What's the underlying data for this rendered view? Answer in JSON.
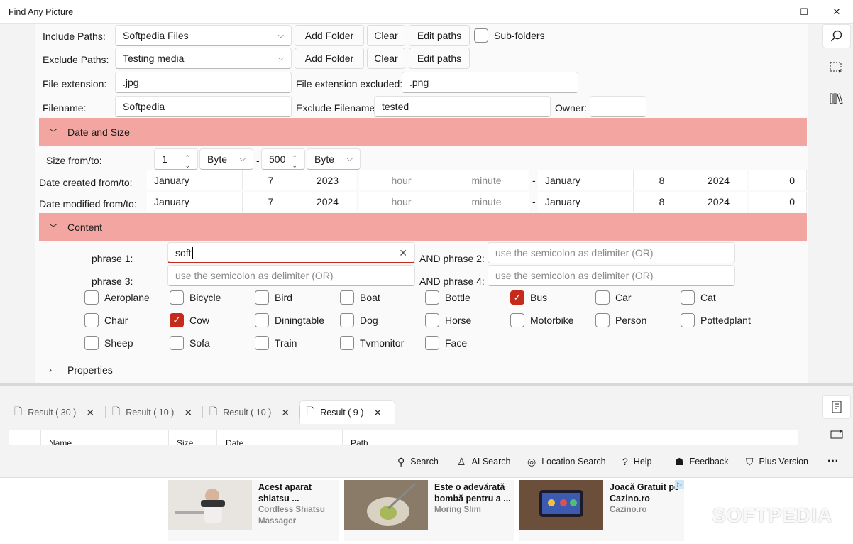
{
  "window": {
    "title": "Find Any Picture",
    "min": "—",
    "max": "☐",
    "close": "✕"
  },
  "include": {
    "label": "Include Paths:",
    "value": "Softpedia Files",
    "add": "Add Folder",
    "clear": "Clear",
    "edit": "Edit paths",
    "subfolders": "Sub-folders"
  },
  "exclude": {
    "label": "Exclude Paths:",
    "value": "Testing media",
    "add": "Add Folder",
    "clear": "Clear",
    "edit": "Edit paths"
  },
  "ext": {
    "label": "File extension:",
    "value": ".jpg",
    "ex_label": "File extension excluded:",
    "ex_value": ".png"
  },
  "fname": {
    "label": "Filename:",
    "value": "Softpedia",
    "ex_label": "Exclude Filename:",
    "ex_value": "tested",
    "owner_label": "Owner:",
    "owner_value": ""
  },
  "date_section": {
    "title": "Date and Size"
  },
  "size": {
    "label": "Size from/to:",
    "from": "1",
    "from_unit": "Byte",
    "dash": "-",
    "to": "500",
    "to_unit": "Byte"
  },
  "created": {
    "label": "Date created from/to:",
    "m1": "January",
    "d1": "7",
    "y1": "2023",
    "hour": "hour",
    "minute": "minute",
    "dash": "-",
    "m2": "January",
    "d2": "8",
    "y2": "2024",
    "h2": "0"
  },
  "modified": {
    "label": "Date modified from/to:",
    "m1": "January",
    "d1": "7",
    "y1": "2024",
    "hour": "hour",
    "minute": "minute",
    "dash": "-",
    "m2": "January",
    "d2": "8",
    "y2": "2024",
    "h2": "0"
  },
  "content_section": {
    "title": "Content"
  },
  "phrases": {
    "p1_label": "phrase 1:",
    "p1_value": "soft",
    "p2_label": "AND phrase 2:",
    "p2_placeholder": "use the semicolon as delimiter (OR)",
    "p3_label": "phrase 3:",
    "p3_placeholder": "use the semicolon as delimiter (OR)",
    "p4_label": "AND phrase 4:",
    "p4_placeholder": "use the semicolon as delimiter (OR)"
  },
  "objects": [
    {
      "label": "Aeroplane",
      "checked": false
    },
    {
      "label": "Bicycle",
      "checked": false
    },
    {
      "label": "Bird",
      "checked": false
    },
    {
      "label": "Boat",
      "checked": false
    },
    {
      "label": "Bottle",
      "checked": false
    },
    {
      "label": "Bus",
      "checked": true
    },
    {
      "label": "Car",
      "checked": false
    },
    {
      "label": "Cat",
      "checked": false
    },
    {
      "label": "Chair",
      "checked": false
    },
    {
      "label": "Cow",
      "checked": true
    },
    {
      "label": "Diningtable",
      "checked": false
    },
    {
      "label": "Dog",
      "checked": false
    },
    {
      "label": "Horse",
      "checked": false
    },
    {
      "label": "Motorbike",
      "checked": false
    },
    {
      "label": "Person",
      "checked": false
    },
    {
      "label": "Pottedplant",
      "checked": false
    },
    {
      "label": "Sheep",
      "checked": false
    },
    {
      "label": "Sofa",
      "checked": false
    },
    {
      "label": "Train",
      "checked": false
    },
    {
      "label": "Tvmonitor",
      "checked": false
    },
    {
      "label": "Face",
      "checked": false
    }
  ],
  "properties_section": {
    "title": "Properties"
  },
  "tabs": [
    {
      "label": "Result ( 30 )"
    },
    {
      "label": "Result ( 10 )"
    },
    {
      "label": "Result ( 10 )"
    },
    {
      "label": "Result ( 9 )"
    }
  ],
  "columns": [
    "Name",
    "Size",
    "Date",
    "Path"
  ],
  "bottombar": {
    "search": "Search",
    "ai": "AI Search",
    "location": "Location Search",
    "help": "Help",
    "feedback": "Feedback",
    "plus": "Plus Version",
    "more": "···"
  },
  "ads": [
    {
      "title": "Acest aparat shiatsu ...",
      "sub": "Cordless Shiatsu Massager"
    },
    {
      "title": "Este o adevărată bombă pentru a ...",
      "sub": "Moring Slim"
    },
    {
      "title": "Joacă Gratuit pe Cazino.ro",
      "sub": "Cazino.ro"
    }
  ],
  "watermark": "SOFTPEDIA",
  "colors": {
    "accent": "#c42b1c",
    "section": "#f2a5a1"
  }
}
